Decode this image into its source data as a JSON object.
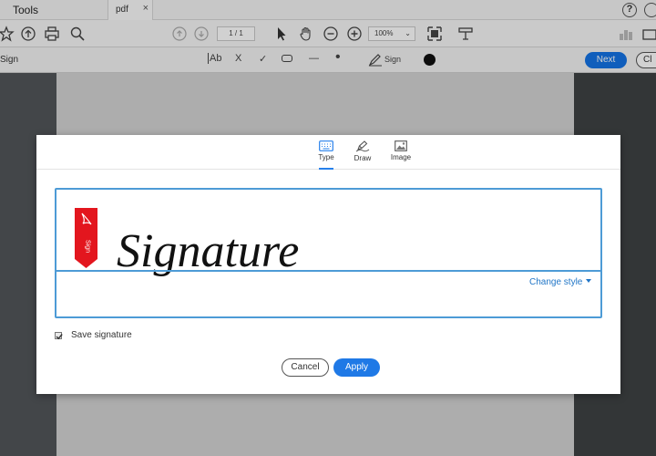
{
  "app": {
    "tools_tab": "Tools",
    "doc_tab": "pdf",
    "doc_tab_close": "×",
    "help": "?",
    "page_indicator": "1 / 1",
    "zoom_value": "100%",
    "sign_title": "Sign",
    "sign_tools": {
      "text": "Ab",
      "cross": "X",
      "check": "✓",
      "line": "—",
      "dot": "•",
      "isign": "Sign",
      "color": "#111111"
    },
    "next_button": "Next",
    "close_button": "Cl"
  },
  "dialog": {
    "tabs": [
      {
        "label": "Type",
        "icon": "keyboard-icon",
        "active": true
      },
      {
        "label": "Draw",
        "icon": "pen-icon",
        "active": false
      },
      {
        "label": "Image",
        "icon": "image-icon",
        "active": false
      }
    ],
    "signature_text": "Signature",
    "sign_flag_text": "Sign",
    "change_style": "Change style",
    "save_signature": {
      "label": "Save signature",
      "checked": true
    },
    "cancel_button": "Cancel",
    "apply_button": "Apply"
  },
  "colors": {
    "accent": "#1f79e6",
    "field_border": "#4d9bd6",
    "flag_red": "#e3161e",
    "ink": "#111111"
  }
}
